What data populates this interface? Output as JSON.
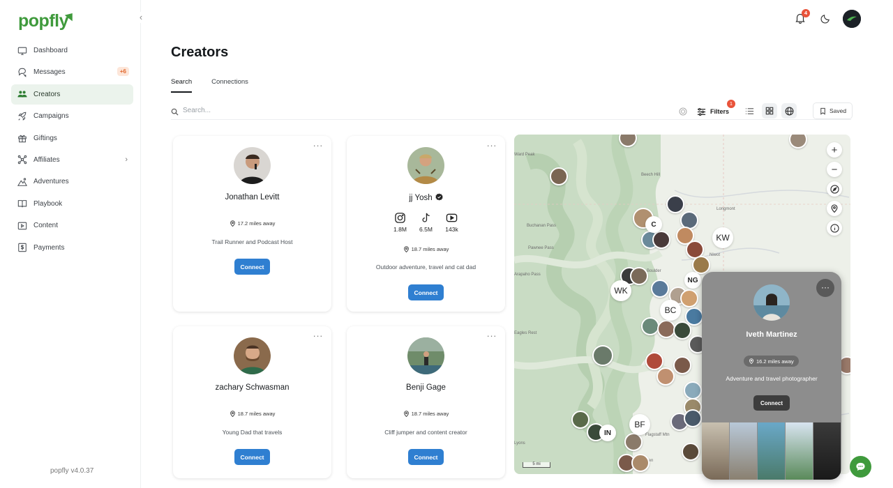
{
  "app": {
    "logo": "popfly",
    "version": "popfly v4.0.37"
  },
  "sidebar": {
    "items": [
      {
        "label": "Dashboard",
        "icon": "monitor-icon"
      },
      {
        "label": "Messages",
        "icon": "chat-icon",
        "badge": "+6"
      },
      {
        "label": "Creators",
        "icon": "users-icon",
        "active": true
      },
      {
        "label": "Campaigns",
        "icon": "rocket-icon"
      },
      {
        "label": "Giftings",
        "icon": "gift-icon"
      },
      {
        "label": "Affiliates",
        "icon": "network-icon",
        "has_chevron": true
      },
      {
        "label": "Adventures",
        "icon": "mountain-icon"
      },
      {
        "label": "Playbook",
        "icon": "book-icon"
      },
      {
        "label": "Content",
        "icon": "play-folder-icon"
      },
      {
        "label": "Payments",
        "icon": "dollar-icon"
      }
    ]
  },
  "header": {
    "notification_count": "4"
  },
  "page": {
    "title": "Creators"
  },
  "tabs": [
    {
      "label": "Search",
      "active": true
    },
    {
      "label": "Connections",
      "active": false
    }
  ],
  "search": {
    "placeholder": "Search...",
    "filters_label": "Filters",
    "filters_count": "1",
    "saved_label": "Saved"
  },
  "creators": [
    {
      "name": "Jonathan Levitt",
      "distance": "17.2 miles away",
      "bio": "Trail Runner and Podcast Host",
      "connect": "Connect",
      "verified": false
    },
    {
      "name": "jj Yosh",
      "distance": "18.7 miles away",
      "bio": "Outdoor adventure, travel and cat dad",
      "connect": "Connect",
      "verified": true,
      "socials": [
        {
          "platform": "instagram",
          "count": "1.8M"
        },
        {
          "platform": "tiktok",
          "count": "6.5M"
        },
        {
          "platform": "youtube",
          "count": "143k"
        }
      ]
    },
    {
      "name": "zachary Schwasman",
      "distance": "18.7 miles away",
      "bio": "Young Dad that travels",
      "connect": "Connect",
      "verified": false
    },
    {
      "name": "Benji Gage",
      "distance": "18.7 miles away",
      "bio": "Cliff jumper and content creator",
      "connect": "Connect",
      "verified": false
    }
  ],
  "map": {
    "labels": [
      "Longmont",
      "Boulder",
      "Beech Hill",
      "Buchanan Pass",
      "Pawnee Pass",
      "Arapaho Pass",
      "Ward Peak",
      "Flagstaff Mtn",
      "Niwot",
      "Lyons",
      "Golden",
      "Eagles Rest"
    ],
    "initials": [
      "KW",
      "WK",
      "BC",
      "NG",
      "BF",
      "IN",
      "C"
    ],
    "scale": "5 mi",
    "popup": {
      "name": "Iveth Martinez",
      "distance": "16.2 miles away",
      "bio": "Adventure and travel photographer",
      "connect": "Connect"
    }
  },
  "colors": {
    "brand": "#3f9a3c",
    "connect": "#2f7fd1",
    "badge": "#e9533a"
  }
}
